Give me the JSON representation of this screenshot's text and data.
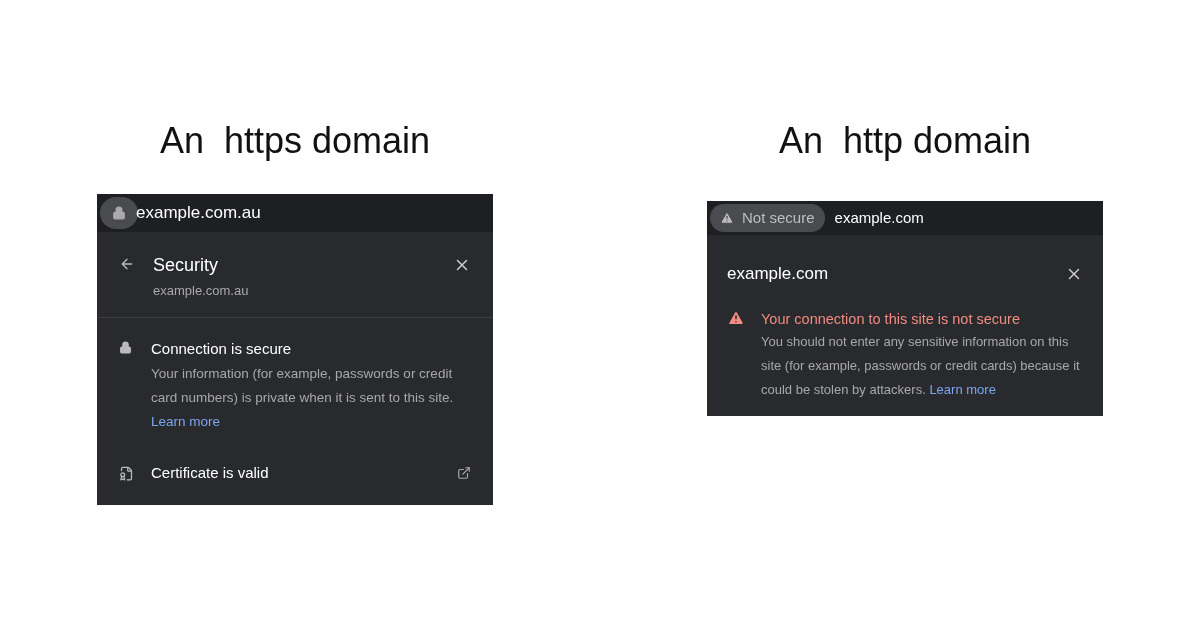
{
  "examples": [
    {
      "kind": "secure",
      "caption": "An  https domain",
      "address_bar": {
        "url": "example.com.au"
      },
      "header": {
        "title": "Security",
        "subtitle": "example.com.au"
      },
      "status": {
        "title": "Connection is secure",
        "body": "Your information (for example, passwords or credit card numbers) is private when it is sent to this site.",
        "link": "Learn more"
      },
      "certificate": {
        "label": "Certificate is valid"
      }
    },
    {
      "kind": "insecure",
      "caption": "An  http domain",
      "address_bar": {
        "badge": "Not secure",
        "url": "example.com"
      },
      "header": {
        "title": "example.com"
      },
      "status": {
        "title": "Your connection to this site is not secure",
        "body": "You should not enter any sensitive information on this site (for example, passwords or credit cards) because it could be stolen by attackers.",
        "link": "Learn more"
      }
    }
  ]
}
